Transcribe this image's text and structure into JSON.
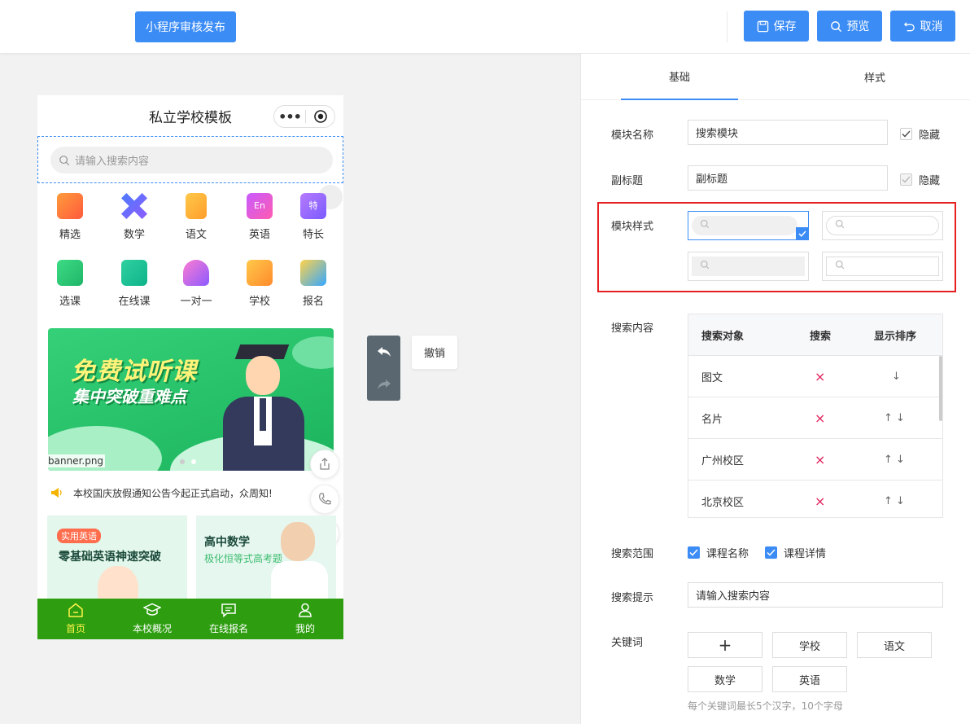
{
  "topbar": {
    "publish_label": "小程序审核发布",
    "save_label": "保存",
    "preview_label": "预览",
    "cancel_label": "取消"
  },
  "phone": {
    "title": "私立学校模板",
    "search_placeholder": "请输入搜索内容",
    "grid_row1": [
      "精选",
      "数学",
      "语文",
      "英语",
      "特长"
    ],
    "grid_row2": [
      "选课",
      "在线课",
      "一对一",
      "学校",
      "报名"
    ],
    "banner": {
      "headline": "免费试听课",
      "subline": "集中突破重难点",
      "filename": "banner.png"
    },
    "notice": "本校国庆放假通知公告今起正式启动，众周知!",
    "card1": {
      "tag": "实用英语",
      "title": "零基础英语神速突破"
    },
    "card2": {
      "title": "高中数学",
      "subtitle": "极化恒等式高考题"
    },
    "tabs": [
      "首页",
      "本校概况",
      "在线报名",
      "我的"
    ]
  },
  "undo": {
    "tip": "撤销"
  },
  "panel": {
    "tabs": [
      "基础",
      "样式"
    ],
    "module_name_label": "模块名称",
    "module_name_value": "搜索模块",
    "hide_label": "隐藏",
    "subtitle_label": "副标题",
    "subtitle_value": "副标题",
    "hide_label2": "隐藏",
    "style_label": "模块样式",
    "content_label": "搜索内容",
    "table": {
      "headers": [
        "搜索对象",
        "搜索",
        "显示排序"
      ],
      "rows": [
        {
          "name": "图文",
          "search": "×",
          "order": "↓"
        },
        {
          "name": "名片",
          "search": "×",
          "order": "↑ ↓"
        },
        {
          "name": "广州校区",
          "search": "×",
          "order": "↑ ↓"
        },
        {
          "name": "北京校区",
          "search": "×",
          "order": "↑ ↓"
        }
      ]
    },
    "scope_label": "搜索范围",
    "scope_options": [
      "课程名称",
      "课程详情"
    ],
    "hint_label": "搜索提示",
    "hint_value": "请输入搜索内容",
    "keywords_label": "关键词",
    "keyword_add": "+",
    "keywords": [
      "学校",
      "语文",
      "数学",
      "英语"
    ],
    "keywords_note": "每个关键词最长5个汉字，10个字母"
  },
  "colors": {
    "accent": "#3b8cf5",
    "tabbar": "#2e9e10",
    "highlight": "#e62020",
    "delete": "#e0245e"
  }
}
